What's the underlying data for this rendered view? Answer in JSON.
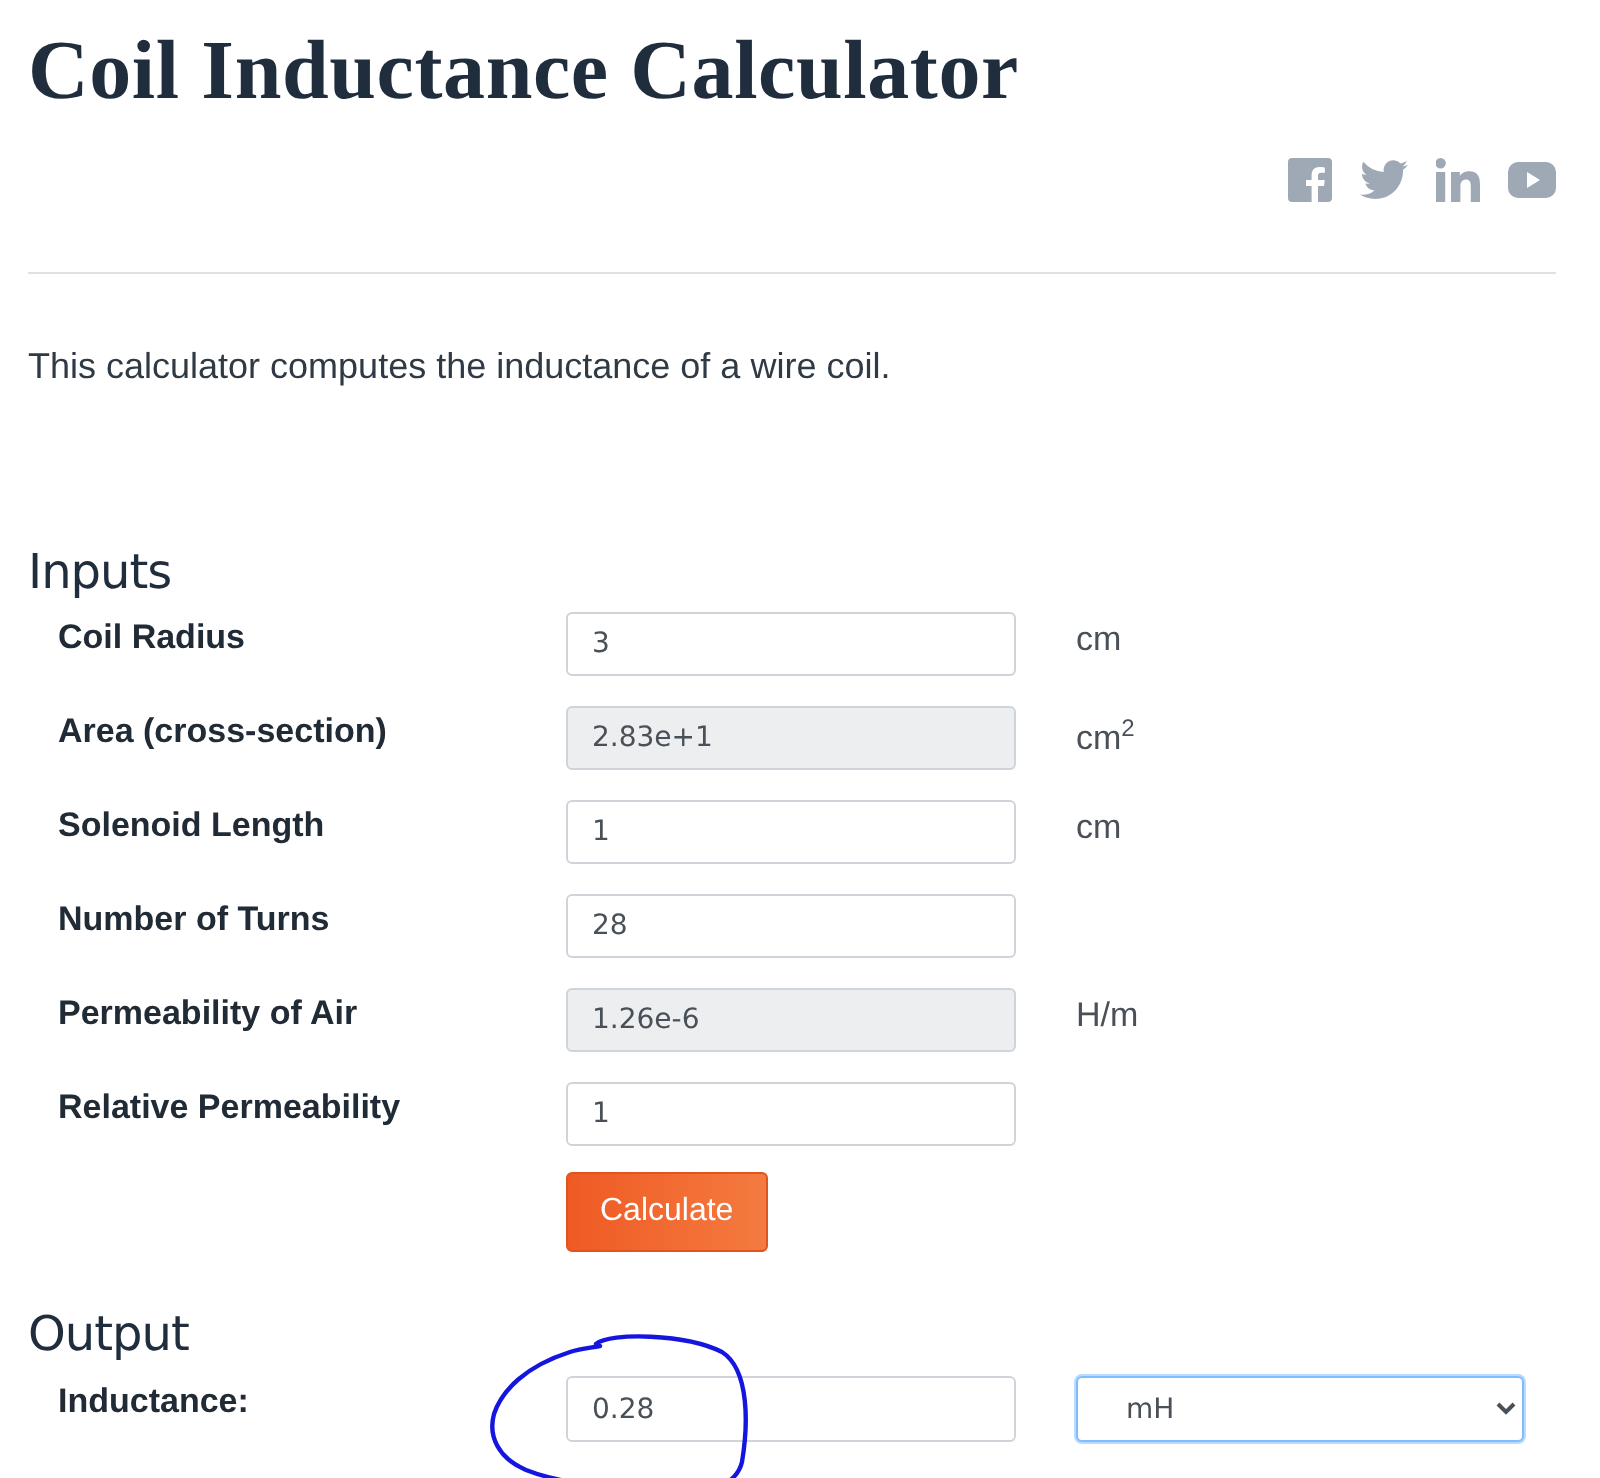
{
  "title": "Coil Inductance Calculator",
  "social": [
    {
      "kind": "facebook"
    },
    {
      "kind": "twitter"
    },
    {
      "kind": "linkedin"
    },
    {
      "kind": "youtube"
    }
  ],
  "description": "This calculator computes the inductance of a wire coil.",
  "inputs": {
    "heading": "Inputs",
    "rows": [
      {
        "label": "Coil Radius",
        "value": "3",
        "disabled": false,
        "unit": "cm"
      },
      {
        "label": "Area (cross-section)",
        "value": "2.83e+1",
        "disabled": true,
        "unit": "cm$^{2}$"
      },
      {
        "label": "Solenoid Length",
        "value": "1",
        "disabled": false,
        "unit": "cm"
      },
      {
        "label": "Number of Turns",
        "value": "28",
        "disabled": false
      },
      {
        "label": "Permeability of Air",
        "value": "1.26e-6",
        "disabled": true,
        "unit": "H/m"
      },
      {
        "label": "Relative Permeability",
        "value": "1",
        "disabled": false
      }
    ],
    "button": "Calculate"
  },
  "output": {
    "heading": "Output",
    "label": "Inductance:",
    "value": "0.28",
    "unit_select": "mH",
    "annotated": true
  }
}
